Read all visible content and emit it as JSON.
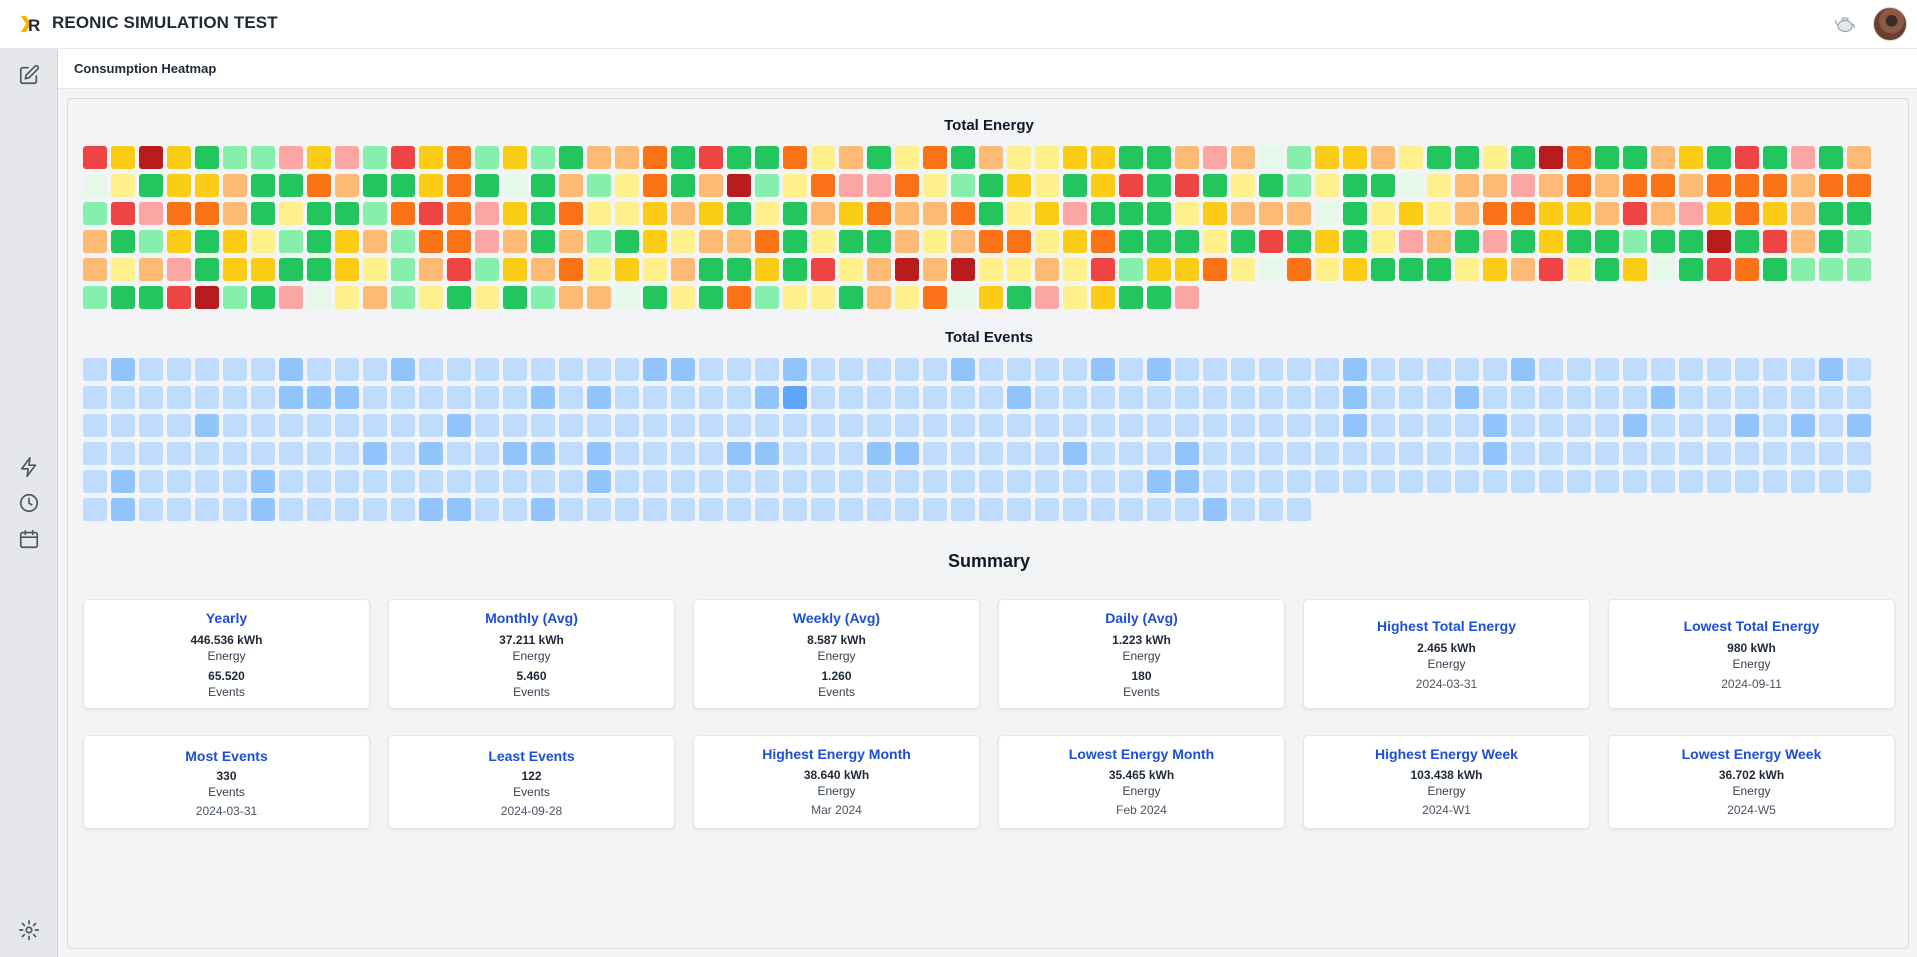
{
  "app": {
    "title": "REONIC SIMULATION TEST"
  },
  "page": {
    "title": "Consumption Heatmap"
  },
  "heatmap": {
    "energy_title": "Total Energy",
    "events_title": "Total Events",
    "columns": 64,
    "last_row_cells": 44,
    "energy_palette": [
      "#e5f8ea",
      "#86efac",
      "#22c55e",
      "#fef08a",
      "#facc15",
      "#fdba74",
      "#f97316",
      "#fca5a5",
      "#ef4444",
      "#b91c1c"
    ],
    "events_palette": [
      "#bfdbfe",
      "#93c5fd",
      "#60a5fa"
    ],
    "energy_levels": [
      8,
      4,
      9,
      4,
      2,
      1,
      1,
      7,
      4,
      7,
      1,
      8,
      4,
      6,
      1,
      4,
      1,
      2,
      5,
      5,
      6,
      2,
      8,
      2,
      2,
      6,
      3,
      5,
      2,
      3,
      6,
      2,
      5,
      3,
      3,
      4,
      4,
      2,
      2,
      5,
      7,
      5,
      0,
      1,
      4,
      4,
      5,
      3,
      2,
      2,
      3,
      2,
      9,
      6,
      2,
      2,
      5,
      4,
      2,
      8,
      2,
      7,
      2,
      5,
      0,
      3,
      2,
      4,
      4,
      5,
      2,
      2,
      6,
      5,
      2,
      2,
      4,
      6,
      2,
      0,
      2,
      5,
      1,
      3,
      6,
      2,
      5,
      9,
      1,
      3,
      6,
      7,
      7,
      6,
      3,
      1,
      2,
      4,
      3,
      2,
      4,
      8,
      2,
      8,
      2,
      3,
      2,
      1,
      3,
      2,
      2,
      0,
      3,
      5,
      5,
      7,
      5,
      6,
      5,
      6,
      6,
      5,
      6,
      6,
      6,
      5,
      6,
      6,
      1,
      8,
      7,
      6,
      6,
      5,
      2,
      3,
      2,
      2,
      1,
      6,
      8,
      6,
      7,
      4,
      2,
      6,
      3,
      3,
      4,
      5,
      4,
      2,
      3,
      2,
      5,
      4,
      6,
      5,
      5,
      6,
      2,
      3,
      4,
      7,
      2,
      2,
      2,
      3,
      4,
      5,
      5,
      5,
      0,
      2,
      3,
      4,
      3,
      5,
      6,
      6,
      4,
      4,
      5,
      8,
      5,
      7,
      4,
      6,
      4,
      5,
      2,
      2,
      5,
      2,
      1,
      4,
      2,
      4,
      3,
      1,
      2,
      4,
      5,
      1,
      6,
      6,
      7,
      5,
      2,
      5,
      1,
      2,
      4,
      3,
      5,
      5,
      6,
      2,
      3,
      2,
      2,
      5,
      3,
      5,
      6,
      6,
      3,
      4,
      6,
      2,
      2,
      2,
      3,
      2,
      8,
      2,
      4,
      2,
      3,
      7,
      5,
      2,
      7,
      2,
      4,
      2,
      2,
      1,
      2,
      2,
      9,
      2,
      8,
      5,
      2,
      1,
      5,
      3,
      5,
      7,
      2,
      4,
      4,
      2,
      2,
      4,
      3,
      1,
      5,
      8,
      1,
      4,
      5,
      6,
      3,
      4,
      3,
      5,
      2,
      2,
      4,
      2,
      8,
      3,
      5,
      9,
      5,
      9,
      3,
      3,
      5,
      3,
      8,
      1,
      4,
      4,
      6,
      3,
      0,
      6,
      3,
      4,
      2,
      2,
      2,
      3,
      4,
      5,
      8,
      3,
      2,
      4,
      0,
      2,
      8,
      6,
      2,
      1,
      1,
      1,
      1,
      2,
      2,
      8,
      9,
      1,
      2,
      7,
      0,
      3,
      5,
      1,
      3,
      2,
      3,
      2,
      1,
      5,
      5,
      0,
      2,
      3,
      2,
      6,
      1,
      3,
      3,
      2,
      5,
      3,
      6,
      0,
      4,
      2,
      7,
      3,
      4,
      2,
      2,
      7
    ],
    "events_levels": [
      0,
      1,
      0,
      0,
      0,
      0,
      0,
      1,
      0,
      0,
      0,
      1,
      0,
      0,
      0,
      0,
      0,
      0,
      0,
      0,
      1,
      1,
      0,
      0,
      0,
      1,
      0,
      0,
      0,
      0,
      0,
      1,
      0,
      0,
      0,
      0,
      1,
      0,
      1,
      0,
      0,
      0,
      0,
      0,
      0,
      1,
      0,
      0,
      0,
      0,
      0,
      1,
      0,
      0,
      0,
      0,
      0,
      0,
      0,
      0,
      0,
      0,
      1,
      0,
      0,
      0,
      0,
      0,
      0,
      0,
      0,
      1,
      1,
      1,
      0,
      0,
      0,
      0,
      0,
      0,
      1,
      0,
      1,
      0,
      0,
      0,
      0,
      0,
      1,
      2,
      0,
      0,
      0,
      0,
      0,
      0,
      0,
      1,
      0,
      0,
      0,
      0,
      0,
      0,
      0,
      0,
      0,
      0,
      0,
      1,
      0,
      0,
      0,
      1,
      0,
      0,
      0,
      0,
      0,
      0,
      1,
      0,
      0,
      0,
      0,
      0,
      0,
      0,
      0,
      0,
      0,
      0,
      1,
      0,
      0,
      0,
      0,
      0,
      0,
      0,
      0,
      1,
      0,
      0,
      0,
      0,
      0,
      0,
      0,
      0,
      0,
      0,
      0,
      0,
      0,
      0,
      0,
      0,
      0,
      0,
      0,
      0,
      0,
      0,
      0,
      0,
      0,
      0,
      0,
      0,
      0,
      0,
      0,
      1,
      0,
      0,
      0,
      0,
      1,
      0,
      0,
      0,
      0,
      1,
      0,
      0,
      0,
      1,
      0,
      1,
      0,
      1,
      0,
      0,
      0,
      0,
      0,
      0,
      0,
      0,
      0,
      0,
      1,
      0,
      1,
      0,
      0,
      1,
      1,
      0,
      1,
      0,
      0,
      0,
      0,
      1,
      1,
      0,
      0,
      0,
      1,
      1,
      0,
      0,
      0,
      0,
      0,
      1,
      0,
      0,
      0,
      1,
      0,
      0,
      0,
      0,
      0,
      0,
      0,
      0,
      0,
      0,
      1,
      0,
      0,
      0,
      0,
      0,
      0,
      0,
      0,
      0,
      0,
      0,
      0,
      0,
      0,
      1,
      0,
      0,
      0,
      0,
      1,
      0,
      0,
      0,
      0,
      0,
      0,
      0,
      0,
      0,
      0,
      0,
      1,
      0,
      0,
      0,
      0,
      0,
      0,
      0,
      0,
      0,
      0,
      0,
      0,
      0,
      0,
      0,
      0,
      0,
      0,
      0,
      1,
      1,
      0,
      0,
      0,
      0,
      0,
      0,
      0,
      0,
      0,
      0,
      0,
      0,
      0,
      0,
      0,
      0,
      0,
      0,
      0,
      0,
      0,
      0,
      0,
      0,
      0,
      1,
      0,
      0,
      0,
      0,
      1,
      0,
      0,
      0,
      0,
      0,
      1,
      1,
      0,
      0,
      1,
      0,
      0,
      0,
      0,
      0,
      0,
      0,
      0,
      0,
      0,
      0,
      0,
      0,
      0,
      0,
      0,
      0,
      0,
      0,
      0,
      0,
      0,
      0,
      1,
      0,
      0,
      0
    ]
  },
  "summary": {
    "title": "Summary",
    "cards": [
      {
        "title": "Yearly",
        "v1": "446.536 kWh",
        "l1": "Energy",
        "v2": "65.520",
        "l2": "Events"
      },
      {
        "title": "Monthly (Avg)",
        "v1": "37.211 kWh",
        "l1": "Energy",
        "v2": "5.460",
        "l2": "Events"
      },
      {
        "title": "Weekly (Avg)",
        "v1": "8.587 kWh",
        "l1": "Energy",
        "v2": "1.260",
        "l2": "Events"
      },
      {
        "title": "Daily (Avg)",
        "v1": "1.223 kWh",
        "l1": "Energy",
        "v2": "180",
        "l2": "Events"
      },
      {
        "title": "Highest Total Energy",
        "v1": "2.465 kWh",
        "l1": "Energy",
        "date": "2024-03-31"
      },
      {
        "title": "Lowest Total Energy",
        "v1": "980 kWh",
        "l1": "Energy",
        "date": "2024-09-11"
      },
      {
        "title": "Most Events",
        "v1": "330",
        "l1": "Events",
        "date": "2024-03-31"
      },
      {
        "title": "Least Events",
        "v1": "122",
        "l1": "Events",
        "date": "2024-09-28"
      },
      {
        "title": "Highest Energy Month",
        "v1": "38.640 kWh",
        "l1": "Energy",
        "date": "Mar 2024"
      },
      {
        "title": "Lowest Energy Month",
        "v1": "35.465 kWh",
        "l1": "Energy",
        "date": "Feb 2024"
      },
      {
        "title": "Highest Energy Week",
        "v1": "103.438 kWh",
        "l1": "Energy",
        "date": "2024-W1"
      },
      {
        "title": "Lowest Energy Week",
        "v1": "36.702 kWh",
        "l1": "Energy",
        "date": "2024-W5"
      }
    ]
  },
  "icons": {
    "logo": "reonic-logo-icon",
    "edit": "edit-icon",
    "lightning": "lightning-icon",
    "clock": "clock-icon",
    "calendar": "calendar-icon",
    "settings": "gear-icon",
    "teapot": "teapot-icon",
    "avatar": "avatar"
  },
  "colors": {
    "accent": "#1d4ed8",
    "logo_yellow": "#f5b400"
  }
}
